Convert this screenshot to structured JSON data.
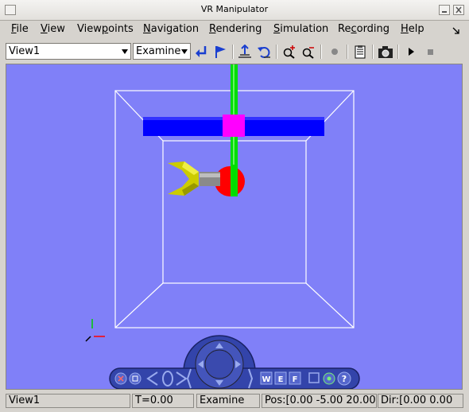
{
  "window": {
    "title": "VR Manipulator"
  },
  "menu": [
    {
      "label": "File",
      "u": "F",
      "rest": "ile"
    },
    {
      "label": "View",
      "u": "V",
      "rest": "iew"
    },
    {
      "label": "Viewpoints",
      "pre": "View",
      "u": "p",
      "rest": "oints"
    },
    {
      "label": "Navigation",
      "u": "N",
      "rest": "avigation"
    },
    {
      "label": "Rendering",
      "u": "R",
      "rest": "endering"
    },
    {
      "label": "Simulation",
      "u": "S",
      "rest": "imulation"
    },
    {
      "label": "Recording",
      "pre": "Re",
      "u": "c",
      "rest": "ording"
    },
    {
      "label": "Help",
      "u": "H",
      "rest": "elp"
    }
  ],
  "toolbar": {
    "viewpoint_select": "View1",
    "nav_mode_select": "Examine",
    "icons": [
      "go-back-icon",
      "flag-icon",
      "straighten-icon",
      "undo-move-icon",
      "zoom-in-icon",
      "zoom-out-icon",
      "record-dot-icon",
      "clipboard-icon",
      "camera-icon",
      "play-icon",
      "stop-icon"
    ]
  },
  "scene": {
    "background": "#8080f8",
    "gripper_color": "#cccc00",
    "joint_color": "#ff0000",
    "bar_color": "#0000ff",
    "slider_color": "#ff00ff",
    "pole_color": "#00dd00"
  },
  "navpanel": {
    "w_label": "W",
    "e_label": "E",
    "f_label": "F",
    "help_label": "?"
  },
  "status": {
    "viewpoint": "View1",
    "time": "T=0.00",
    "mode": "Examine",
    "pos": "Pos:[0.00 -5.00 20.00]",
    "dir": "Dir:[0.00 0.00"
  }
}
